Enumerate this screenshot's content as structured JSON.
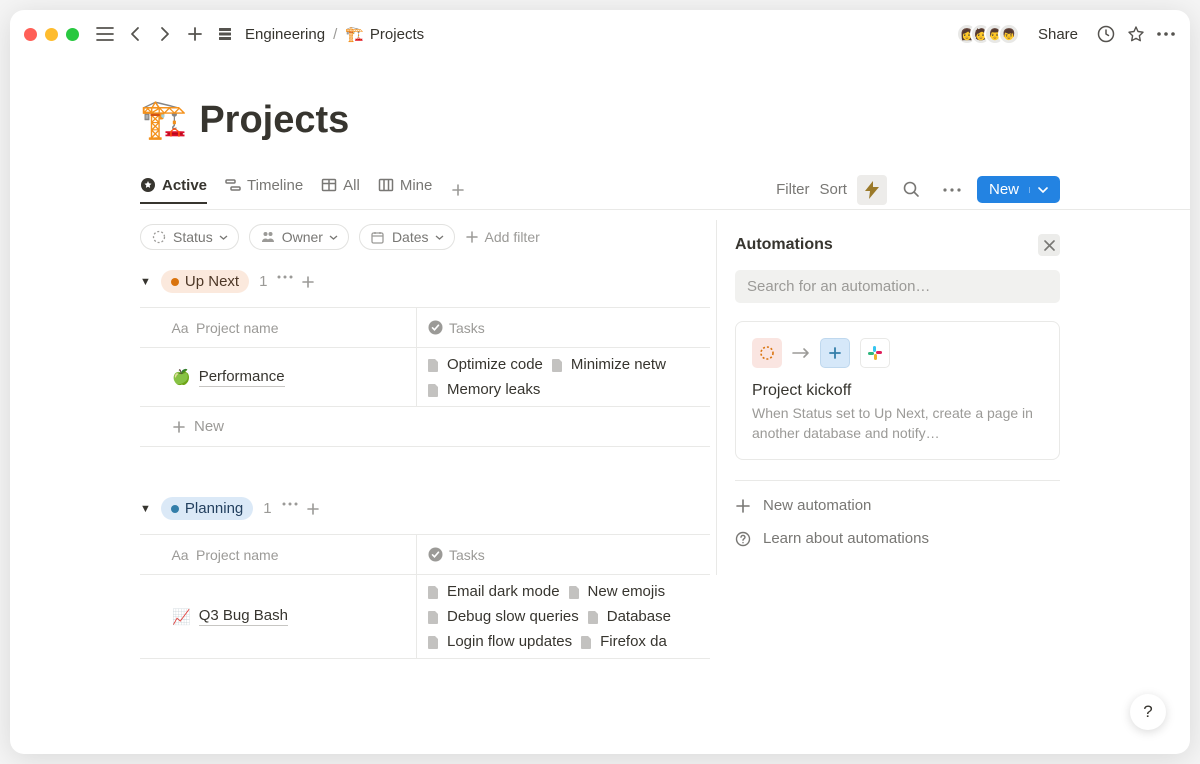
{
  "breadcrumb": {
    "parent": "Engineering",
    "current": "Projects",
    "icon": "🏗️"
  },
  "titlebar": {
    "share": "Share"
  },
  "page": {
    "icon": "🏗️",
    "title": "Projects"
  },
  "tabs": [
    {
      "label": "Active",
      "active": true
    },
    {
      "label": "Timeline",
      "active": false
    },
    {
      "label": "All",
      "active": false
    },
    {
      "label": "Mine",
      "active": false
    }
  ],
  "toolbar": {
    "filter": "Filter",
    "sort": "Sort",
    "new_label": "New"
  },
  "filters": {
    "status": "Status",
    "owner": "Owner",
    "dates": "Dates",
    "add": "Add filter"
  },
  "columns": {
    "name": "Project name",
    "tasks": "Tasks"
  },
  "new_row": "New",
  "groups": [
    {
      "name": "Up Next",
      "count": "1",
      "color": "orange",
      "rows": [
        {
          "icon": "🍏",
          "name": "Performance",
          "tasks": [
            "Optimize code",
            "Minimize netw",
            "Memory leaks"
          ]
        }
      ]
    },
    {
      "name": "Planning",
      "count": "1",
      "color": "blue",
      "rows": [
        {
          "icon": "📈",
          "name": "Q3 Bug Bash",
          "tasks": [
            "Email dark mode",
            "New emojis",
            "Debug slow queries",
            "Database",
            "Login flow updates",
            "Firefox da"
          ]
        }
      ]
    }
  ],
  "automations": {
    "title": "Automations",
    "search_placeholder": "Search for an automation…",
    "card": {
      "title": "Project kickoff",
      "desc": "When Status set to Up Next, create a page in another database and notify…"
    },
    "new_link": "New automation",
    "learn_link": "Learn about automations"
  },
  "help": "?"
}
